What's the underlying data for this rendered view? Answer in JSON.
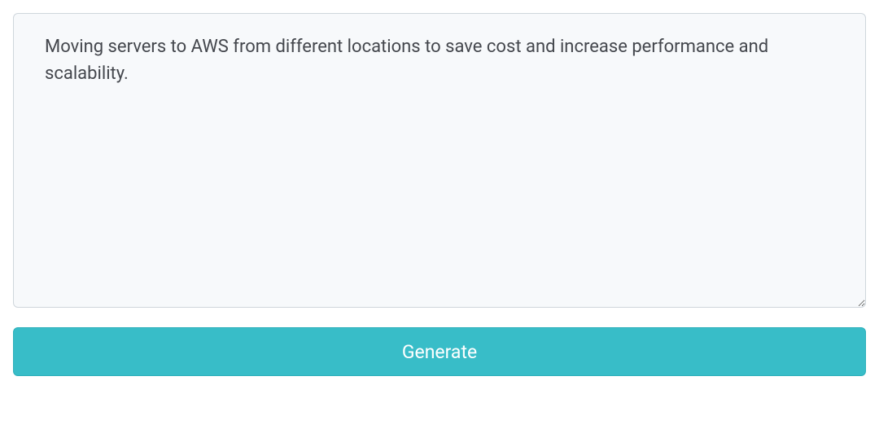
{
  "form": {
    "textarea_value": "Moving servers to AWS from different locations to save cost and increase performance and scalability.",
    "textarea_placeholder": "",
    "generate_label": "Generate"
  },
  "colors": {
    "button_bg": "#38bdc8",
    "button_text": "#ffffff",
    "textarea_bg": "#f7f9fb",
    "textarea_border": "#cfd6dc",
    "text_color": "#44474d"
  }
}
